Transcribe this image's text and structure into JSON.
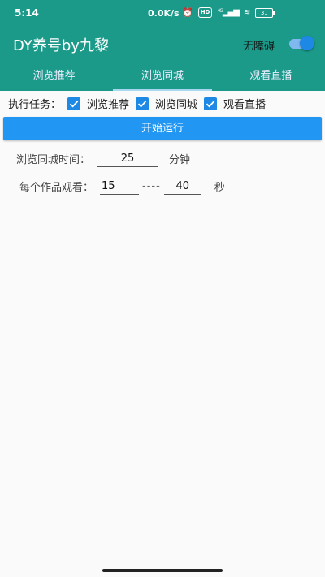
{
  "status_bar": {
    "time": "5:14",
    "speed": "0.0K/s",
    "hd_label": "HD",
    "signal_label": "4G",
    "battery": "31"
  },
  "app_bar": {
    "title": "DY养号by九黎",
    "accessibility_label": "无障碍",
    "accessibility_on": true
  },
  "tabs": [
    {
      "label": "浏览推荐",
      "active": false
    },
    {
      "label": "浏览同城",
      "active": true
    },
    {
      "label": "观看直播",
      "active": false
    }
  ],
  "tasks": {
    "label": "执行任务：",
    "items": [
      {
        "label": "浏览推荐",
        "checked": true
      },
      {
        "label": "浏览同城",
        "checked": true
      },
      {
        "label": "观看直播",
        "checked": true
      }
    ]
  },
  "start_button": "开始运行",
  "browse_time": {
    "label": "浏览同城时间：",
    "value": "25",
    "unit": "分钟"
  },
  "watch_time": {
    "label": "每个作品观看：",
    "min": "15",
    "separator": "----",
    "max": "40",
    "unit": "秒"
  },
  "colors": {
    "primary": "#1b9a8a",
    "accent": "#2196f3",
    "checkbox": "#1e88e5"
  }
}
